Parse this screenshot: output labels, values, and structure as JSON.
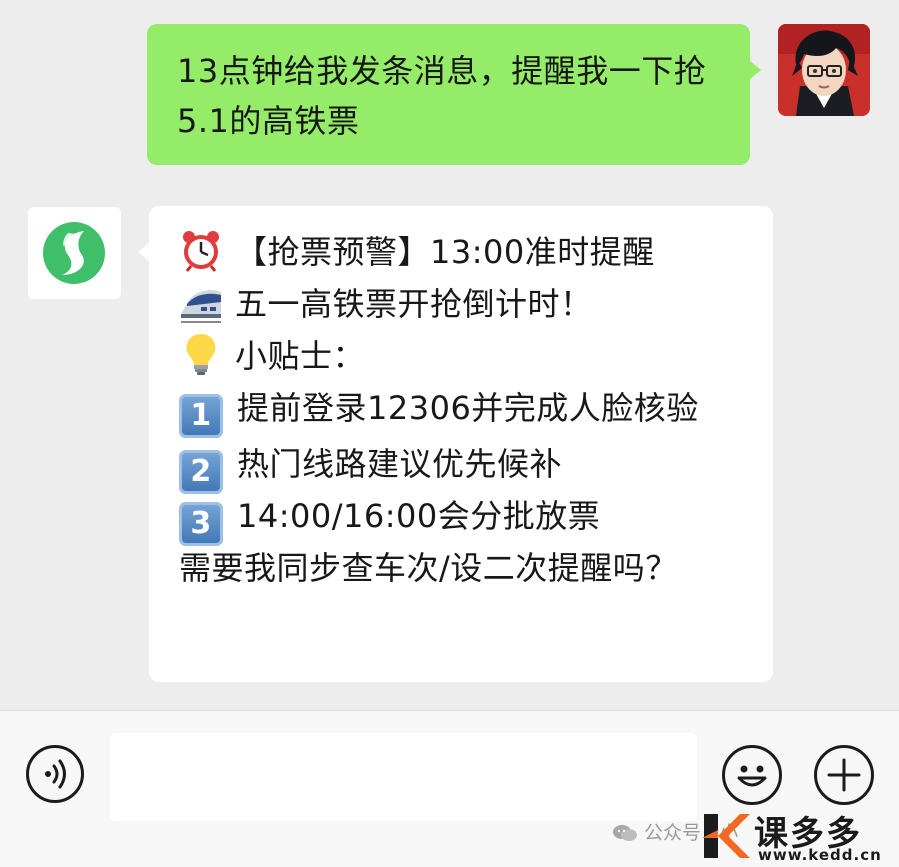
{
  "conversation": {
    "messages": [
      {
        "sender": "user",
        "text": "13点钟给我发条消息，提醒我一下抢5.1的高铁票"
      },
      {
        "sender": "assistant",
        "lines": [
          {
            "icon": "alarm-clock-icon",
            "text": "【抢票预警】13:00准时提醒"
          },
          {
            "icon": "high-speed-train-icon",
            "text": "五一高铁票开抢倒计时！"
          },
          {
            "icon": "light-bulb-icon",
            "text": "小贴士："
          },
          {
            "icon": "keycap-1-icon",
            "keycap": "1",
            "text": "提前登录12306并完成人脸核验"
          },
          {
            "icon": "keycap-2-icon",
            "keycap": "2",
            "text": "热门线路建议优先候补"
          },
          {
            "icon": "keycap-3-icon",
            "keycap": "3",
            "text": "14:00/16:00会分批放票"
          },
          {
            "icon": null,
            "text": "需要我同步查车次/设二次提醒吗？"
          }
        ]
      }
    ]
  },
  "input_bar": {
    "voice_icon": "voice-input-icon",
    "text_value": "",
    "emoji_icon": "smiley-icon",
    "more_icon": "plus-icon"
  },
  "watermark": {
    "text": "公众号 · 小",
    "brand_name": "课多多",
    "brand_url": "www.kedd.cn"
  },
  "colors": {
    "chat_background": "#ededed",
    "user_bubble": "#95ec69",
    "assistant_bubble": "#ffffff",
    "bot_logo": "#3fbf6a",
    "brand_orange": "#f26a21"
  }
}
